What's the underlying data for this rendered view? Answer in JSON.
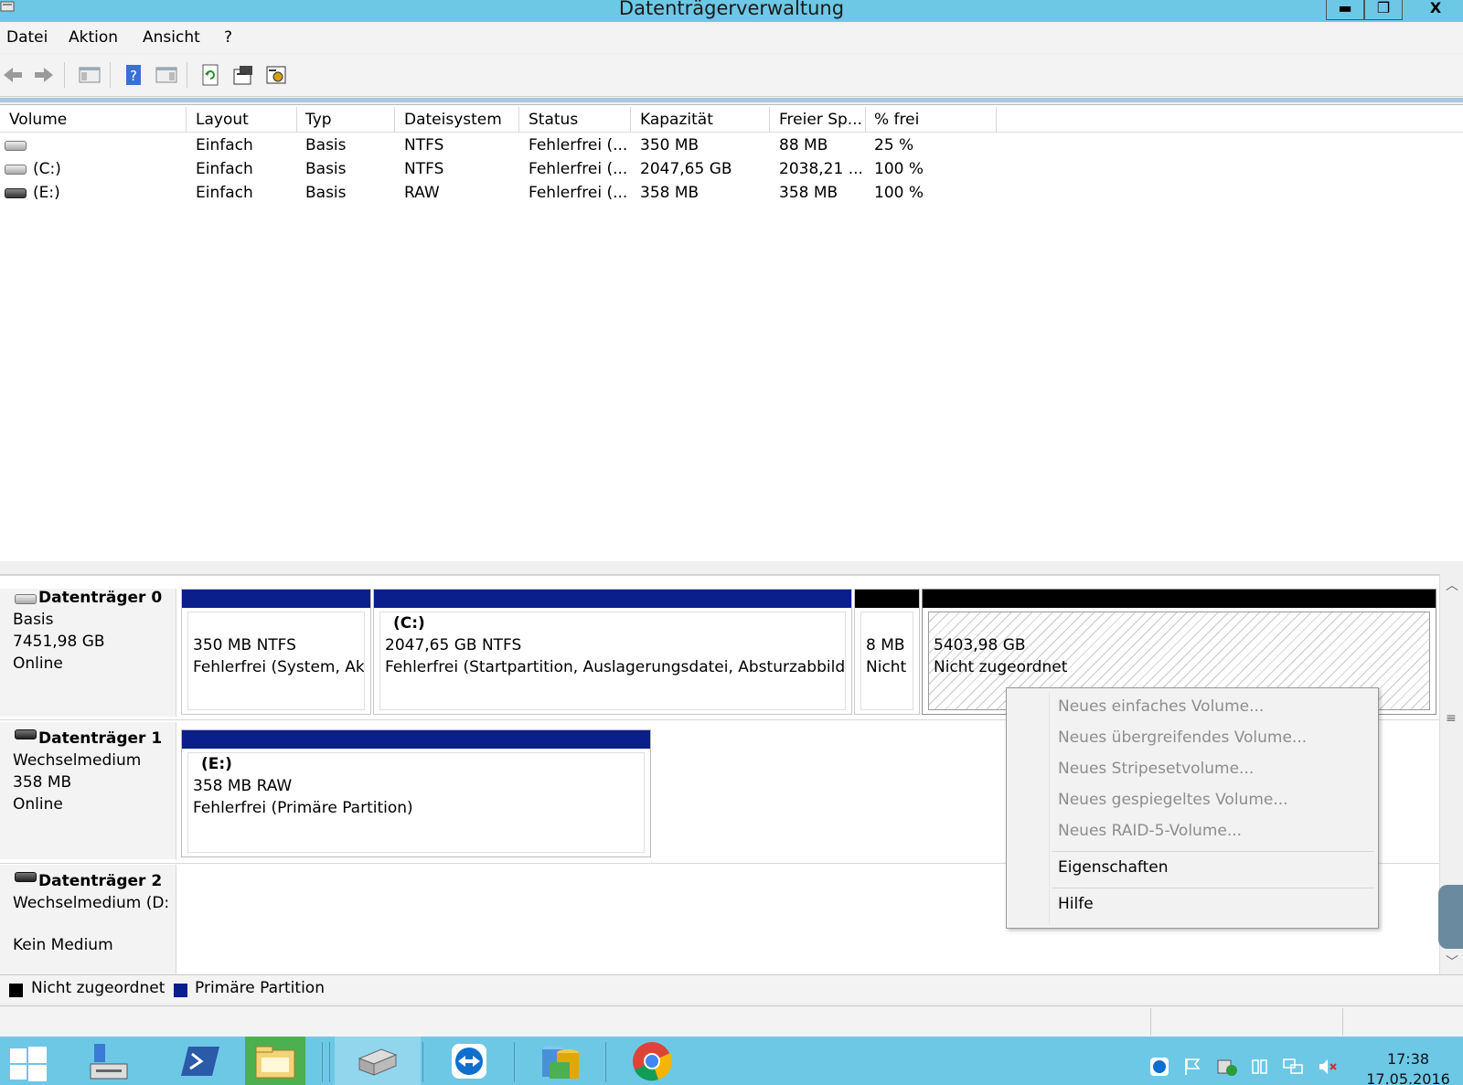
{
  "window": {
    "title": "Datenträgerverwaltung",
    "buttons": {
      "minimize": "▬",
      "restore": "❐",
      "close": "X"
    }
  },
  "menu": [
    "Datei",
    "Aktion",
    "Ansicht",
    "?"
  ],
  "toolbar": {
    "icons": [
      "back-arrow-icon",
      "forward-arrow-icon",
      "show-hide-console-tree-icon",
      "help-icon",
      "show-hide-action-pane-icon",
      "refresh-icon",
      "properties-icon",
      "settings-icon"
    ]
  },
  "volume_list": {
    "columns": [
      "Volume",
      "Layout",
      "Typ",
      "Dateisystem",
      "Status",
      "Kapazität",
      "Freier Sp...",
      "% frei"
    ],
    "rows": [
      {
        "volume": "",
        "layout": "Einfach",
        "typ": "Basis",
        "dateisystem": "NTFS",
        "status": "Fehlerfrei (...",
        "kapazitaet": "350 MB",
        "frei": "88 MB",
        "prozent": "25 %"
      },
      {
        "volume": "(C:)",
        "layout": "Einfach",
        "typ": "Basis",
        "dateisystem": "NTFS",
        "status": "Fehlerfrei (...",
        "kapazitaet": "2047,65 GB",
        "frei": "2038,21 ...",
        "prozent": "100 %"
      },
      {
        "volume": "(E:)",
        "layout": "Einfach",
        "typ": "Basis",
        "dateisystem": "RAW",
        "status": "Fehlerfrei (...",
        "kapazitaet": "358 MB",
        "frei": "358 MB",
        "prozent": "100 %"
      }
    ]
  },
  "disks": [
    {
      "name": "Datenträger 0",
      "lines": [
        "Basis",
        "7451,98 GB",
        "Online"
      ],
      "partitions": [
        {
          "title": "",
          "size": "350 MB NTFS",
          "status": "Fehlerfrei (System, Akt"
        },
        {
          "title": "(C:)",
          "size": "2047,65 GB NTFS",
          "status": "Fehlerfrei (Startpartition, Auslagerungsdatei, Absturzabbild, I"
        },
        {
          "title": "",
          "size": "8 MB",
          "status": "Nicht"
        },
        {
          "title": "",
          "size": "5403,98 GB",
          "status": "Nicht zugeordnet"
        }
      ]
    },
    {
      "name": "Datenträger 1",
      "lines": [
        "Wechselmedium",
        "358 MB",
        "Online"
      ],
      "partitions": [
        {
          "title": "(E:)",
          "size": "358 MB RAW",
          "status": "Fehlerfrei (Primäre Partition)"
        }
      ]
    },
    {
      "name": "Datenträger 2",
      "lines": [
        "Wechselmedium (D:",
        "",
        "Kein Medium"
      ]
    }
  ],
  "legend": [
    {
      "label": "Nicht zugeordnet",
      "color": "#000000"
    },
    {
      "label": "Primäre Partition",
      "color": "#0a1e8c"
    }
  ],
  "context_menu": {
    "items": [
      {
        "label": "Neues einfaches Volume...",
        "enabled": false
      },
      {
        "label": "Neues übergreifendes Volume...",
        "enabled": false
      },
      {
        "label": "Neues Stripesetvolume...",
        "enabled": false
      },
      {
        "label": "Neues gespiegeltes Volume...",
        "enabled": false
      },
      {
        "label": "Neues RAID-5-Volume...",
        "enabled": false
      },
      {
        "label": "Eigenschaften",
        "enabled": true
      },
      {
        "label": "Hilfe",
        "enabled": true
      }
    ]
  },
  "taskbar": {
    "apps": [
      "start-icon",
      "server-manager-icon",
      "powershell-icon",
      "file-explorer-icon",
      "disk-management-icon",
      "teamviewer-icon",
      "database-icon",
      "chrome-icon"
    ],
    "tray": [
      "teamviewer-tray-icon",
      "flag-icon",
      "security-icon",
      "network-adapter-icon",
      "network-icon",
      "speaker-muted-icon"
    ],
    "time": "17:38",
    "date": "17.05.2016"
  },
  "colors": {
    "titlebar": "#6dc8e6",
    "primary_partition": "#0a1e8c",
    "unallocated": "#000000"
  }
}
